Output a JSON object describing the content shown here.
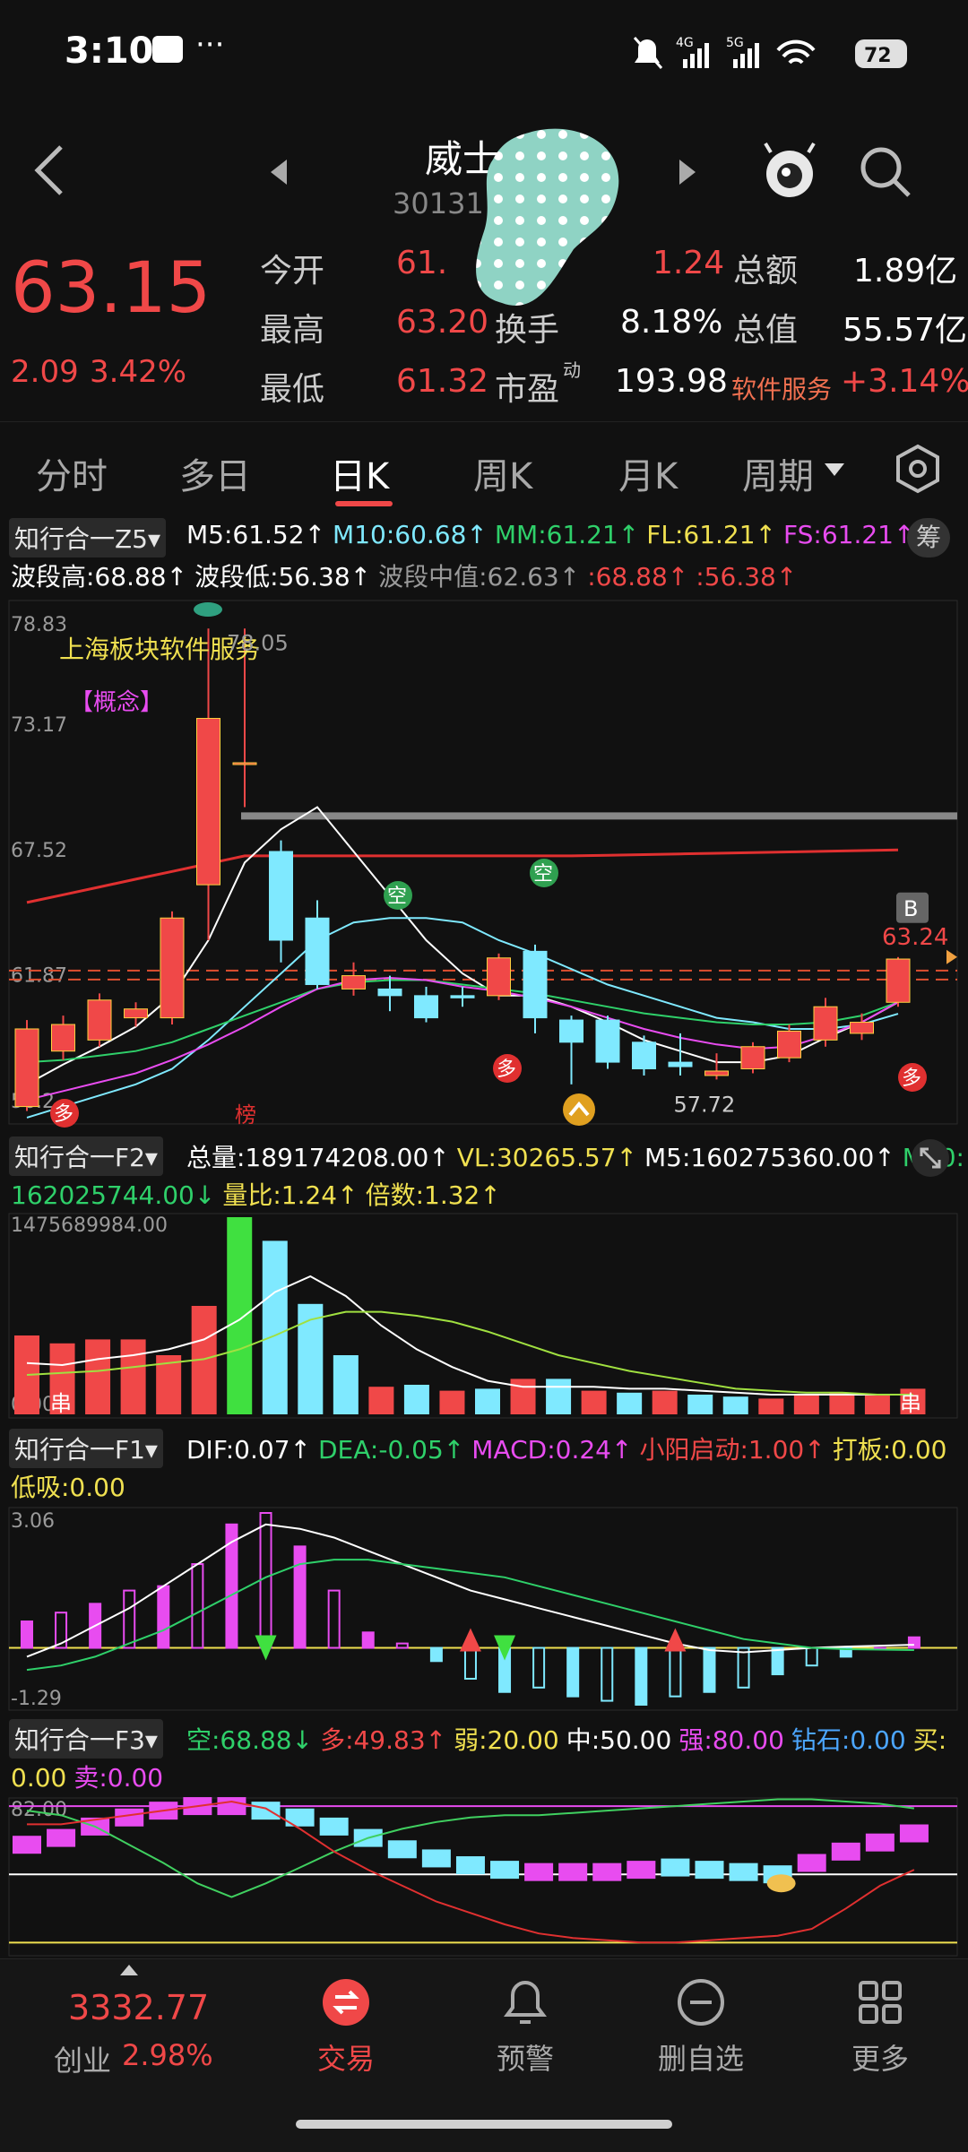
{
  "status_bar": {
    "time": "3:10",
    "dots": "···",
    "battery": "72",
    "net1": "4G",
    "net2": "5G"
  },
  "header": {
    "title": "威士",
    "code": "30131",
    "back_icon": "chevron-left-icon",
    "prev_icon": "triangle-left-icon",
    "next_icon": "triangle-right-icon",
    "search_icon": "search-icon"
  },
  "quote": {
    "price": "63.15",
    "change": "2.09",
    "change_pct": "3.42%",
    "rows": [
      {
        "k1": "今开",
        "v1": "61.",
        "k2": "",
        "v2": "1.24",
        "k3": "总额",
        "v3": "1.89亿"
      },
      {
        "k1": "最高",
        "v1": "63.20",
        "k2": "换手",
        "v2": "8.18%",
        "k3": "总值",
        "v3": "55.57亿"
      },
      {
        "k1": "最低",
        "v1": "61.32",
        "k2": "市盈",
        "sup": "动",
        "v2": "193.98",
        "k3": "软件服务",
        "v3": "+3.14%"
      }
    ]
  },
  "tabs": [
    "分时",
    "多日",
    "日K",
    "周K",
    "月K",
    "周期"
  ],
  "main_chart": {
    "selector": "知行合一Z5",
    "line1": [
      {
        "t": "M5:61.52↑",
        "c": "white"
      },
      {
        "t": "M10:60.68↑",
        "c": "cyan"
      },
      {
        "t": "MM:61.21↑",
        "c": "green"
      },
      {
        "t": "FL:61.21↑",
        "c": "yellow"
      },
      {
        "t": "FS:61.21↑",
        "c": "magenta"
      }
    ],
    "line2": [
      {
        "t": "波段高:68.88↑",
        "c": "white"
      },
      {
        "t": "波段低:56.38↑",
        "c": "white"
      },
      {
        "t": "波段中值:62.63↑",
        "c": "gray"
      },
      {
        "t": ":68.88↑",
        "c": "red"
      },
      {
        "t": ":56.38↑",
        "c": "red"
      }
    ],
    "chip_label": "筹",
    "y_labels": [
      "78.83",
      "73.17",
      "67.52",
      "61.87",
      "56.2"
    ],
    "annot_sector": "上海板块软件服务",
    "annot_concept": "【概念】",
    "high_label": "78.05",
    "low_label": "57.72",
    "last_label": "63.24",
    "badge_b": "B",
    "badge_kong": "空",
    "badge_duo": "多",
    "badge_bang": "榜",
    "candles": [
      {
        "o": 56.5,
        "c": 60.0,
        "h": 60.4,
        "l": 56.3
      },
      {
        "o": 59.0,
        "c": 60.2,
        "h": 60.6,
        "l": 58.6
      },
      {
        "o": 59.5,
        "c": 61.3,
        "h": 61.6,
        "l": 59.2
      },
      {
        "o": 60.5,
        "c": 60.9,
        "h": 61.2,
        "l": 60.1
      },
      {
        "o": 60.5,
        "c": 65.0,
        "h": 65.3,
        "l": 60.2
      },
      {
        "o": 66.5,
        "c": 74.0,
        "h": 78.05,
        "l": 64.0
      },
      {
        "o": 72.0,
        "c": 72.0,
        "h": 78.05,
        "l": 70.0
      },
      {
        "o": 68.0,
        "c": 64.0,
        "h": 68.5,
        "l": 63.0
      },
      {
        "o": 65.0,
        "c": 62.0,
        "h": 65.8,
        "l": 61.8
      },
      {
        "o": 61.8,
        "c": 62.4,
        "h": 63.0,
        "l": 61.5
      },
      {
        "o": 61.8,
        "c": 61.5,
        "h": 62.4,
        "l": 60.8
      },
      {
        "o": 61.5,
        "c": 60.5,
        "h": 61.9,
        "l": 60.3
      },
      {
        "o": 61.5,
        "c": 61.4,
        "h": 61.9,
        "l": 61.0
      },
      {
        "o": 61.5,
        "c": 63.2,
        "h": 63.4,
        "l": 61.3
      },
      {
        "o": 63.5,
        "c": 60.5,
        "h": 63.8,
        "l": 59.8
      },
      {
        "o": 60.4,
        "c": 59.4,
        "h": 60.6,
        "l": 57.5
      },
      {
        "o": 60.4,
        "c": 58.5,
        "h": 60.6,
        "l": 58.2
      },
      {
        "o": 59.4,
        "c": 58.2,
        "h": 59.7,
        "l": 57.9
      },
      {
        "o": 58.5,
        "c": 58.3,
        "h": 59.8,
        "l": 57.9
      },
      {
        "o": 57.9,
        "c": 58.1,
        "h": 58.9,
        "l": 57.72
      },
      {
        "o": 58.2,
        "c": 59.2,
        "h": 59.4,
        "l": 58.0
      },
      {
        "o": 58.7,
        "c": 59.9,
        "h": 60.2,
        "l": 58.5
      },
      {
        "o": 59.5,
        "c": 61.0,
        "h": 61.4,
        "l": 59.2
      },
      {
        "o": 59.8,
        "c": 60.3,
        "h": 60.7,
        "l": 59.5
      },
      {
        "o": 61.2,
        "c": 63.15,
        "h": 63.24,
        "l": 61.0
      }
    ],
    "ma5": [
      57.5,
      58.4,
      59.2,
      60.1,
      61.5,
      64.0,
      67.5,
      69.0,
      70.0,
      68.0,
      66.0,
      64.0,
      62.5,
      61.5,
      61.5,
      61.0,
      60.3,
      59.5,
      59.0,
      58.5,
      58.5,
      58.8,
      59.6,
      60.3,
      61.2
    ],
    "ma10": [
      56.0,
      56.5,
      57.0,
      57.5,
      58.2,
      59.5,
      61.0,
      62.5,
      64.0,
      64.8,
      65.0,
      65.0,
      64.8,
      64.0,
      63.4,
      62.7,
      62.0,
      61.5,
      61.0,
      60.5,
      60.3,
      60.0,
      60.0,
      60.2,
      60.68
    ],
    "ma20": [
      58.5,
      58.6,
      58.8,
      59.0,
      59.4,
      60.0,
      60.6,
      61.2,
      61.8,
      62.1,
      62.2,
      62.2,
      62.0,
      61.8,
      61.6,
      61.3,
      61.0,
      60.7,
      60.5,
      60.3,
      60.2,
      60.2,
      60.3,
      60.6,
      61.21
    ],
    "mm": [
      56.8,
      57.2,
      57.6,
      58.0,
      58.6,
      59.3,
      60.1,
      61.0,
      61.8,
      62.2,
      62.3,
      62.2,
      61.9,
      61.7,
      61.4,
      61.0,
      60.5,
      60.0,
      59.6,
      59.3,
      59.1,
      59.2,
      59.7,
      60.3,
      61.21
    ],
    "resistance": 67.8,
    "mid_value": 62.63,
    "gray_line": 69.6
  },
  "volume_chart": {
    "selector": "知行合一F2",
    "line1": [
      {
        "t": "总量:189174208.00↑",
        "c": "white"
      },
      {
        "t": "VL:30265.57↑",
        "c": "yellow"
      },
      {
        "t": "M5:160275360.00↑",
        "c": "white"
      },
      {
        "t": "M10:",
        "c": "green"
      }
    ],
    "line2": [
      {
        "t": "162025744.00↓",
        "c": "green"
      },
      {
        "t": "量比:1.24↑",
        "c": "yellow"
      },
      {
        "t": "倍数:1.32↑",
        "c": "yellow"
      }
    ],
    "y_top": "1475689984.00",
    "y_bottom": "0.00",
    "tag": "串",
    "vol": [
      40,
      36,
      38,
      38,
      30,
      55,
      100,
      88,
      56,
      30,
      14,
      15,
      12,
      13,
      18,
      18,
      12,
      11,
      12,
      10,
      9,
      8,
      10,
      11,
      10,
      13
    ],
    "color": [
      "r",
      "r",
      "r",
      "r",
      "r",
      "r",
      "g",
      "c",
      "c",
      "c",
      "r",
      "c",
      "r",
      "c",
      "r",
      "c",
      "r",
      "c",
      "r",
      "c",
      "c",
      "r",
      "r",
      "r",
      "r",
      "r"
    ],
    "ma5": [
      26,
      25,
      28,
      30,
      33,
      38,
      48,
      62,
      70,
      60,
      45,
      33,
      24,
      17,
      14,
      14,
      14,
      13,
      13,
      12,
      11,
      10,
      10,
      10,
      10,
      10
    ],
    "ma10": [
      20,
      21,
      22,
      24,
      26,
      28,
      33,
      40,
      48,
      52,
      52,
      50,
      47,
      42,
      36,
      30,
      26,
      22,
      19,
      16,
      13,
      12,
      11,
      11,
      10,
      10
    ]
  },
  "macd_chart": {
    "selector": "知行合一F1",
    "line1": [
      {
        "t": "DIF:0.07↑",
        "c": "white"
      },
      {
        "t": "DEA:-0.05↑",
        "c": "green"
      },
      {
        "t": "MACD:0.24↑",
        "c": "magenta"
      },
      {
        "t": "小阳启动:1.00↑",
        "c": "red"
      },
      {
        "t": "打板:0.00",
        "c": "yellow"
      }
    ],
    "line2": [
      {
        "t": "低吸:0.00",
        "c": "yellow"
      }
    ],
    "y_top": "3.06",
    "y_bottom": "-1.29",
    "hist": [
      0.6,
      0.8,
      1.0,
      1.3,
      1.4,
      1.9,
      2.8,
      3.06,
      2.3,
      1.3,
      0.35,
      0.1,
      -0.3,
      -0.7,
      -1.0,
      -0.9,
      -1.1,
      -1.2,
      -1.29,
      -1.1,
      -1.0,
      -0.9,
      -0.6,
      -0.4,
      -0.2,
      0.0,
      0.24
    ],
    "dif": [
      -0.2,
      0.1,
      0.5,
      0.9,
      1.4,
      1.9,
      2.4,
      2.8,
      2.7,
      2.5,
      2.2,
      1.9,
      1.6,
      1.3,
      1.1,
      0.9,
      0.7,
      0.5,
      0.3,
      0.1,
      -0.05,
      -0.1,
      -0.05,
      0.0,
      0.03,
      0.05,
      0.07
    ],
    "dea": [
      -0.5,
      -0.4,
      -0.2,
      0.1,
      0.4,
      0.8,
      1.2,
      1.6,
      1.9,
      2.0,
      2.0,
      1.9,
      1.8,
      1.7,
      1.6,
      1.4,
      1.2,
      1.0,
      0.8,
      0.6,
      0.4,
      0.2,
      0.1,
      0.0,
      -0.03,
      -0.04,
      -0.05
    ]
  },
  "f3_chart": {
    "selector": "知行合一F3",
    "line1": [
      {
        "t": "空:68.88↓",
        "c": "green"
      },
      {
        "t": "多:49.83↑",
        "c": "red"
      },
      {
        "t": "弱:20.00",
        "c": "yellow"
      },
      {
        "t": "中:50.00",
        "c": "white"
      },
      {
        "t": "强:80.00",
        "c": "magenta"
      },
      {
        "t": "钻石:0.00",
        "c": "blue"
      },
      {
        "t": "买:",
        "c": "yellow"
      }
    ],
    "line2": [
      {
        "t": "0.00",
        "c": "yellow"
      },
      {
        "t": "卖:0.00",
        "c": "magenta"
      }
    ],
    "y_top": "82.00",
    "bars": [
      63,
      66,
      71,
      75,
      78,
      80,
      80,
      78,
      75,
      71,
      66,
      61,
      57,
      54,
      52,
      51,
      51,
      51,
      52,
      53,
      52,
      51,
      50,
      55,
      60,
      64,
      68
    ],
    "bar_colors": [
      "m",
      "m",
      "m",
      "m",
      "m",
      "m",
      "m",
      "c",
      "c",
      "c",
      "c",
      "c",
      "c",
      "c",
      "c",
      "m",
      "m",
      "m",
      "m",
      "c",
      "c",
      "c",
      "c",
      "m",
      "m",
      "m",
      "m"
    ],
    "green_line": [
      78,
      76,
      71,
      63,
      55,
      46,
      40,
      46,
      53,
      60,
      66,
      70,
      73,
      75,
      76,
      76,
      77,
      78,
      79,
      80,
      81,
      82,
      83,
      83,
      82,
      81,
      79
    ],
    "red_line": [
      72,
      72,
      74,
      76,
      78,
      80,
      82,
      79,
      70,
      60,
      52,
      45,
      38,
      33,
      28,
      24,
      22,
      21,
      20,
      20,
      21,
      22,
      23,
      26,
      35,
      45,
      52
    ]
  },
  "bottom_nav": {
    "index_value": "3332.77",
    "index_name": "创业",
    "index_pct": "2.98%",
    "items": [
      {
        "label": "交易",
        "icon": "trade-icon"
      },
      {
        "label": "预警",
        "icon": "bell-icon"
      },
      {
        "label": "删自选",
        "icon": "minus-circle-icon"
      },
      {
        "label": "更多",
        "icon": "grid-icon"
      }
    ]
  },
  "colors": {
    "up": "#f04848",
    "down": "#7fe9ff",
    "bg": "#111111"
  }
}
